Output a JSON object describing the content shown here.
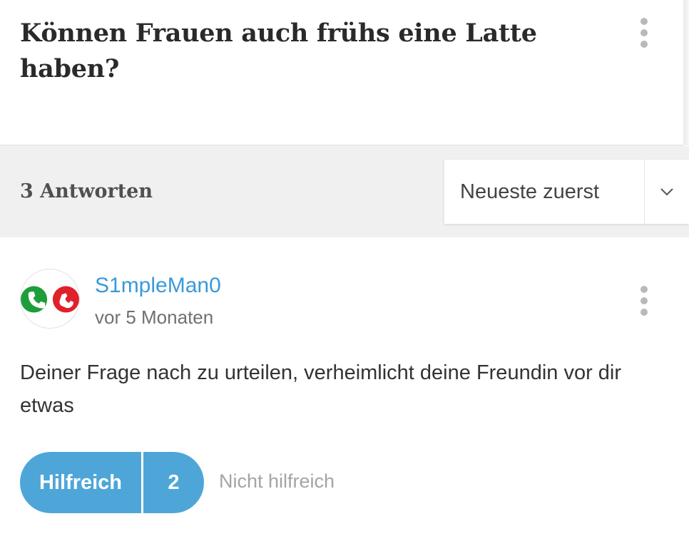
{
  "question": {
    "title": "Können Frauen auch frühs eine Latte haben?",
    "menu_icon": "more-vertical-icon"
  },
  "answers_header": {
    "count_label": "3 Antworten",
    "sort": {
      "selected": "Neueste zuerst",
      "chevron_icon": "chevron-down-icon"
    }
  },
  "answer": {
    "author": "S1mpleMan0",
    "timestamp": "vor 5 Monaten",
    "avatar_icon": "phone-accept-decline-icon",
    "menu_icon": "more-vertical-icon",
    "text": "Deiner Frage nach zu urteilen, verheimlicht deine Freundin vor dir etwas",
    "helpful_label": "Hilfreich",
    "helpful_count": "2",
    "not_helpful_label": "Nicht hilfreich"
  },
  "colors": {
    "accent_blue": "#4ea6d8",
    "link_blue": "#3a9ad9",
    "bar_gray": "#f0f0f0",
    "accept_green": "#1e9e3a",
    "decline_red": "#e0202a"
  }
}
